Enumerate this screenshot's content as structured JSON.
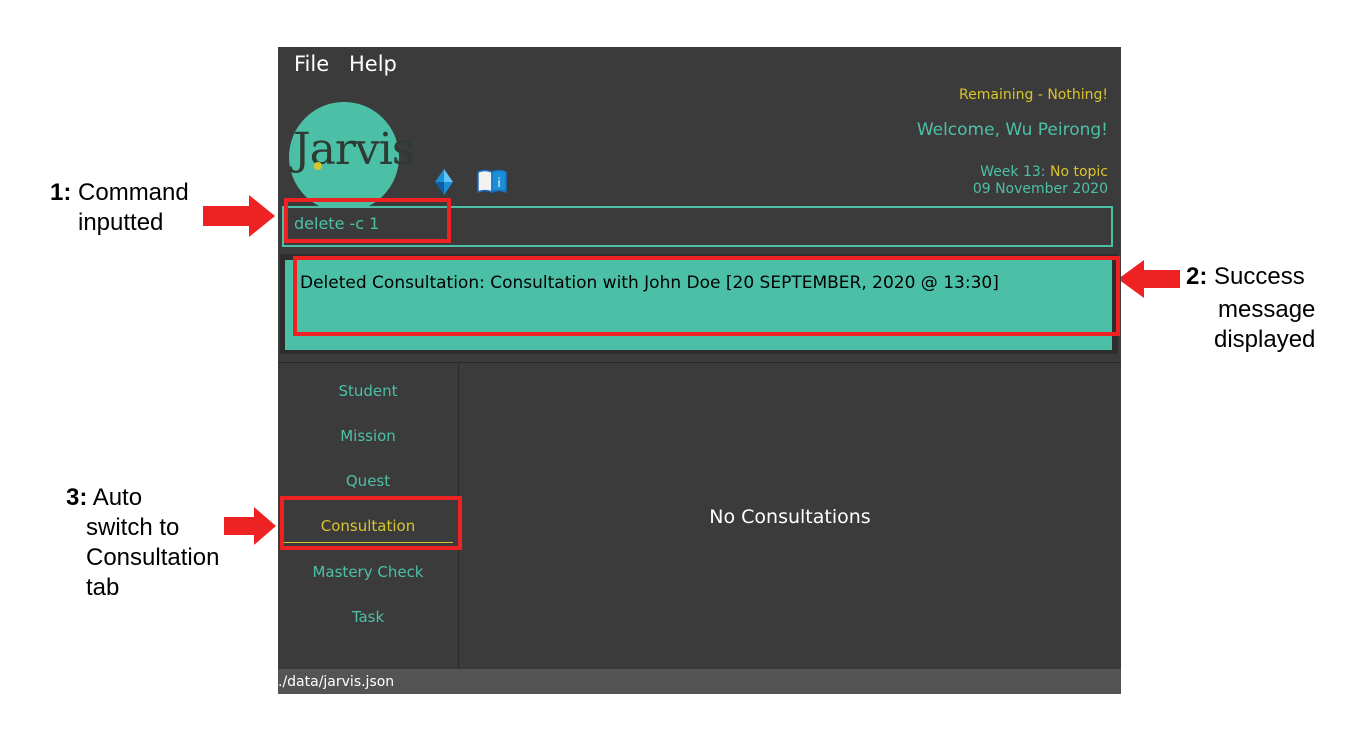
{
  "annotations": {
    "a1": {
      "num": "1:",
      "line1": "Command",
      "line2": "inputted"
    },
    "a2": {
      "num": "2:",
      "line1": "Success",
      "line2": "message",
      "line3": "displayed"
    },
    "a3": {
      "num": "3:",
      "line1": "Auto",
      "line2": "switch to",
      "line3": "Consultation",
      "line4": "tab"
    }
  },
  "menu": {
    "file": "File",
    "help": "Help"
  },
  "header": {
    "logo_text": "Jarvis",
    "remaining": "Remaining - Nothing!",
    "welcome": "Welcome, Wu Peirong!",
    "week_prefix": "Week 13: ",
    "week_topic": "No topic",
    "date": "09 November 2020"
  },
  "icons": {
    "gem": "gem-icon",
    "book": "info-book-icon"
  },
  "command": {
    "value": "delete -c 1"
  },
  "result": {
    "message": "Deleted Consultation: Consultation with John Doe [20 SEPTEMBER, 2020 @ 13:30]"
  },
  "tabs": [
    {
      "label": "Student"
    },
    {
      "label": "Mission"
    },
    {
      "label": "Quest"
    },
    {
      "label": "Consultation"
    },
    {
      "label": "Mastery Check"
    },
    {
      "label": "Task"
    }
  ],
  "active_tab": "Consultation",
  "main": {
    "empty_text": "No Consultations"
  },
  "status": {
    "path": "./data/jarvis.json"
  },
  "colors": {
    "accent": "#4cc0a6",
    "highlight": "#d8c42e",
    "background": "#3b3b3b",
    "annotation_red": "#ee2222"
  }
}
